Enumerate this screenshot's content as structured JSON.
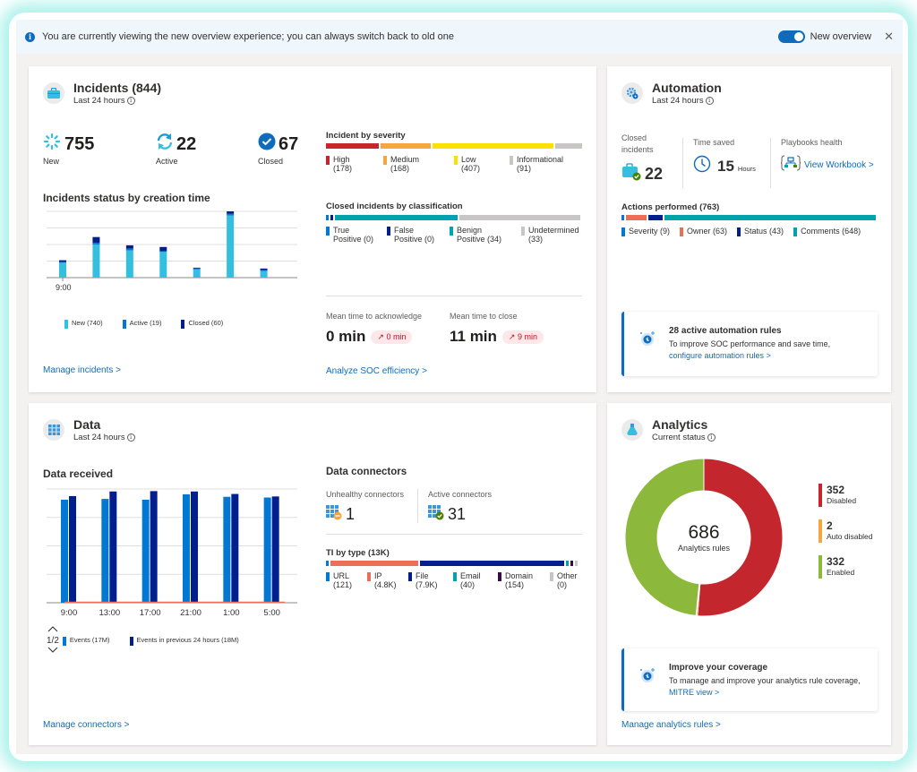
{
  "banner": {
    "message": "You are currently viewing the new overview experience; you can always switch back to old one",
    "toggle_label": "New overview",
    "toggle_on": true,
    "close_glyph": "✕"
  },
  "incidents": {
    "title": "Incidents (844)",
    "subtitle": "Last 24 hours",
    "stats": [
      {
        "value": "755",
        "label": "New",
        "icon": "new-spinner-icon"
      },
      {
        "value": "22",
        "label": "Active",
        "icon": "refresh-icon"
      },
      {
        "value": "67",
        "label": "Closed",
        "icon": "checkmark-circle-icon"
      }
    ],
    "chart_title": "Incidents status by creation time",
    "link": "Manage incidents >",
    "severity": {
      "title": "Incident by severity",
      "items": [
        {
          "label": "High",
          "count": "(178)",
          "value": 178,
          "color": "#c4262e"
        },
        {
          "label": "Medium",
          "count": "(168)",
          "value": 168,
          "color": "#f7a541"
        },
        {
          "label": "Low",
          "count": "(407)",
          "value": 407,
          "color": "#fce100"
        },
        {
          "label": "Informational",
          "count": "(91)",
          "value": 91,
          "color": "#c8c6c4"
        }
      ]
    },
    "classification": {
      "title": "Closed incidents by classification",
      "items": [
        {
          "label1": "True",
          "label2": "Positive (0)",
          "value": 0,
          "color": "#0078d4"
        },
        {
          "label1": "False",
          "label2": "Positive (0)",
          "value": 0,
          "color": "#001f8f"
        },
        {
          "label1": "Benign",
          "label2": "Positive (34)",
          "value": 34,
          "color": "#00a2ad"
        },
        {
          "label1": "Undetermined",
          "label2": "(33)",
          "value": 33,
          "color": "#c8c6c4"
        }
      ]
    },
    "mtta": {
      "label": "Mean time to acknowledge",
      "value": "0 min",
      "delta": "↗ 0 min"
    },
    "mttc": {
      "label": "Mean time to close",
      "value": "11 min",
      "delta": "↗ 9 min"
    },
    "soc_link": "Analyze SOC efficiency >"
  },
  "automation": {
    "title": "Automation",
    "subtitle": "Last 24 hours",
    "closed_label": "Closed incidents",
    "closed_value": "22",
    "time_saved_label": "Time saved",
    "time_saved_value": "15",
    "time_saved_unit": "Hours",
    "playbooks_label": "Playbooks health",
    "playbooks_link": "View Workbook >",
    "actions": {
      "title": "Actions performed (763)",
      "items": [
        {
          "label": "Severity (9)",
          "value": 9,
          "color": "#0078d4"
        },
        {
          "label": "Owner (63)",
          "value": 63,
          "color": "#ee6d56"
        },
        {
          "label": "Status (43)",
          "value": 43,
          "color": "#001f8f"
        },
        {
          "label": "Comments (648)",
          "value": 648,
          "color": "#00a2ad"
        }
      ]
    },
    "callout": {
      "title": "28 active automation rules",
      "text": "To improve SOC performance and save time,",
      "link": "configure automation rules >"
    }
  },
  "data": {
    "title": "Data",
    "subtitle": "Last 24 hours",
    "chart_title": "Data received",
    "legend_page": "1/2",
    "link": "Manage connectors >",
    "connectors": {
      "title": "Data connectors",
      "unhealthy_label": "Unhealthy connectors",
      "unhealthy_value": "1",
      "active_label": "Active connectors",
      "active_value": "31"
    },
    "ti": {
      "title": "TI by type (13K)",
      "items": [
        {
          "label1": "URL",
          "label2": "(121)",
          "value": 121,
          "color": "#0078d4"
        },
        {
          "label1": "IP",
          "label2": "(4.8K)",
          "value": 4800,
          "color": "#ee6d56"
        },
        {
          "label1": "File",
          "label2": "(7.9K)",
          "value": 7900,
          "color": "#001f8f"
        },
        {
          "label1": "Email",
          "label2": "(40)",
          "value": 40,
          "color": "#00a2ad"
        },
        {
          "label1": "Domain",
          "label2": "(154)",
          "value": 154,
          "color": "#3b0a45"
        },
        {
          "label1": "Other",
          "label2": "(0)",
          "value": 0,
          "color": "#c8c6c4"
        }
      ]
    }
  },
  "analytics": {
    "title": "Analytics",
    "subtitle": "Current status",
    "center_value": "686",
    "center_label": "Analytics rules",
    "legend": [
      {
        "value": "352",
        "label": "Disabled",
        "color": "#c4262e"
      },
      {
        "value": "2",
        "label": "Auto disabled",
        "color": "#f7a541"
      },
      {
        "value": "332",
        "label": "Enabled",
        "color": "#8cb83c"
      }
    ],
    "callout": {
      "title": "Improve your coverage",
      "text": "To manage and improve your analytics rule coverage,",
      "link": "MITRE view >"
    },
    "link": "Manage analytics rules >"
  },
  "chart_data": [
    {
      "type": "bar",
      "title": "Incidents status by creation time",
      "stacked": true,
      "categories": [
        "9:00",
        "",
        "",
        "",
        "",
        "",
        ""
      ],
      "tick_labels": [
        "9:00"
      ],
      "series": [
        {
          "name": "New (740)",
          "color": "#33bfe0",
          "values": [
            18,
            40,
            33,
            31,
            10,
            75,
            8
          ]
        },
        {
          "name": "Active (19)",
          "color": "#0078d4",
          "values": [
            1,
            2,
            2,
            1,
            1,
            2,
            1
          ]
        },
        {
          "name": "Closed (60)",
          "color": "#001f8f",
          "values": [
            2,
            7,
            4,
            5,
            1,
            3,
            2
          ]
        }
      ],
      "ylim": [
        0,
        80
      ],
      "grid": true,
      "legend": "bottom"
    },
    {
      "type": "bar",
      "title": "Data received",
      "categories": [
        "9:00",
        "13:00",
        "17:00",
        "21:00",
        "1:00",
        "5:00"
      ],
      "series": [
        {
          "name": "Events (17M)",
          "color": "#0078d4",
          "values": [
            2.9,
            2.92,
            2.9,
            3.05,
            2.98,
            2.96
          ]
        },
        {
          "name": "Events in previous 24 hours (18M)",
          "color": "#001f8f",
          "values": [
            3.0,
            3.13,
            3.14,
            3.13,
            3.06,
            2.99
          ]
        }
      ],
      "ylim": [
        0,
        3.2
      ],
      "grid": true,
      "legend": "bottom-left"
    },
    {
      "type": "pie",
      "title": "Analytics rules",
      "donut": true,
      "categories": [
        "Disabled",
        "Auto disabled",
        "Enabled"
      ],
      "values": [
        352,
        2,
        332
      ],
      "colors": [
        "#c4262e",
        "#f7a541",
        "#8cb83c"
      ],
      "total": 686
    }
  ]
}
